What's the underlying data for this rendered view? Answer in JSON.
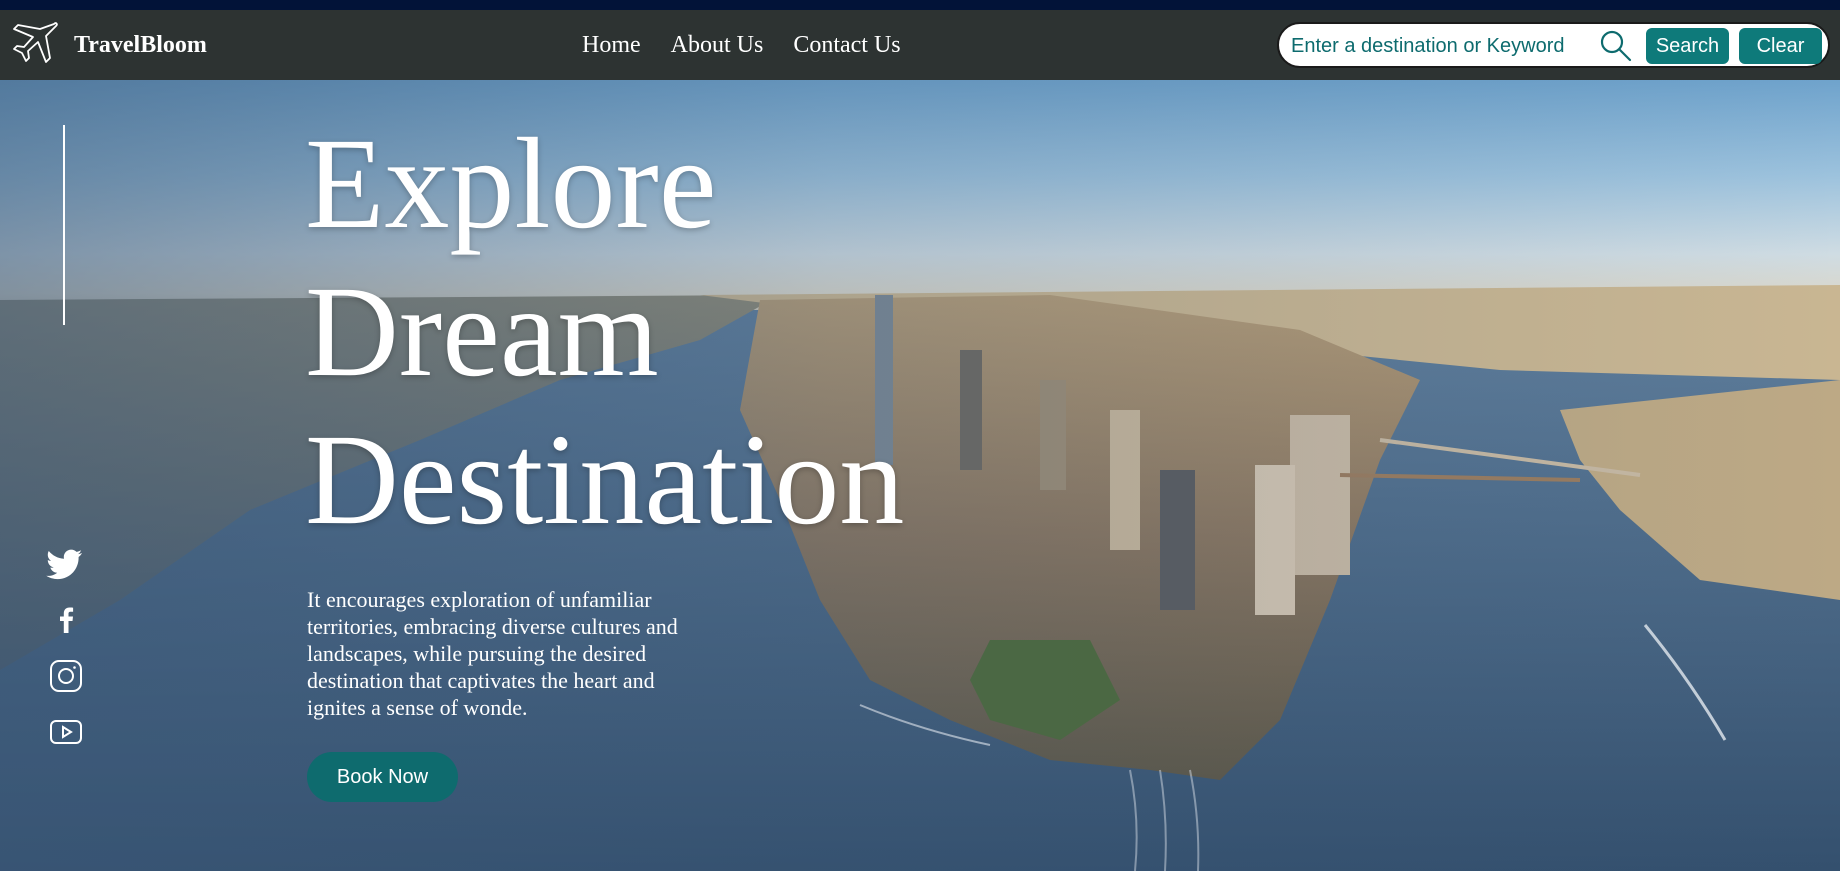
{
  "header": {
    "brand_name": "TravelBloom",
    "nav": [
      "Home",
      "About Us",
      "Contact Us"
    ],
    "search_placeholder": "Enter a destination or Keyword",
    "search_button": "Search",
    "clear_button": "Clear"
  },
  "hero": {
    "headline_lines": [
      "Explore",
      "Dream",
      "Destination"
    ],
    "tagline": "It encourages exploration of unfamiliar territories, embracing diverse cultures and landscapes, while pursuing the desired destination that captivates the heart and ignites a sense of wonde.",
    "cta": "Book Now"
  },
  "social_icons": [
    "twitter-icon",
    "facebook-icon",
    "instagram-icon",
    "youtube-icon"
  ],
  "colors": {
    "navbar": "#2d3332",
    "accent": "#0e7a7a",
    "button_dark": "#0e6b6e",
    "text_light": "#ffffff"
  }
}
